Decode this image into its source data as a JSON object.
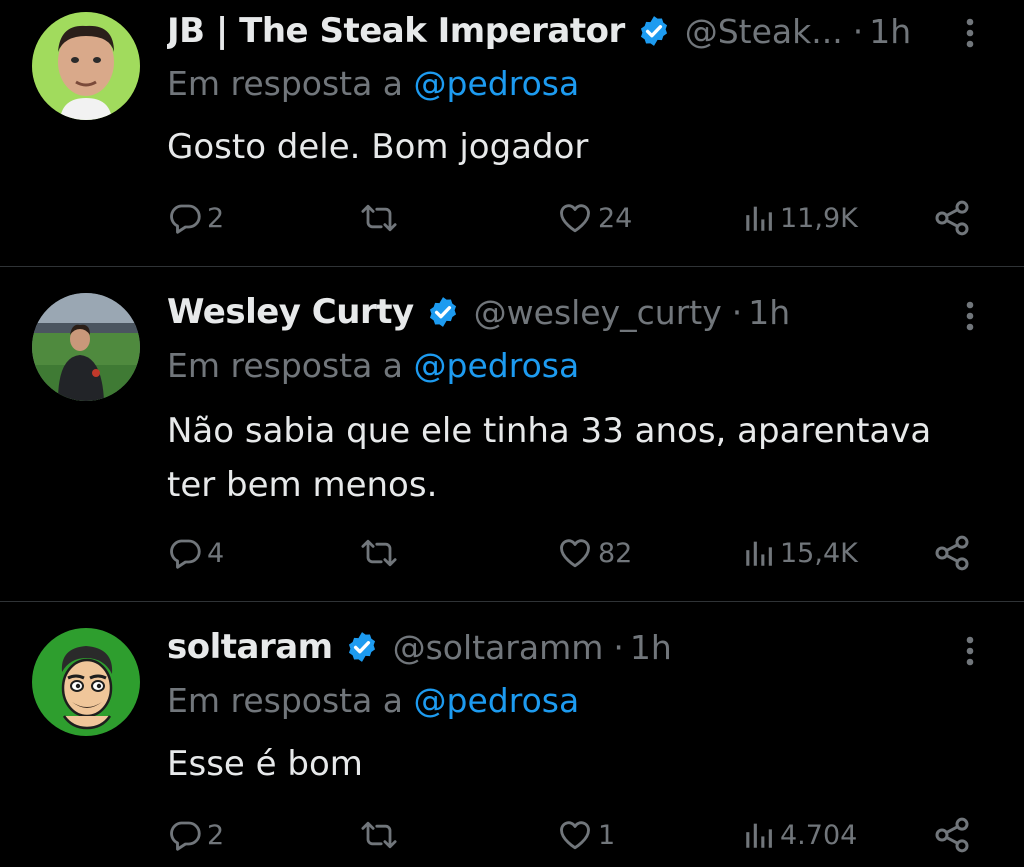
{
  "tweets": [
    {
      "name": "JB | The Steak Imperator",
      "handle": "@Steak...",
      "separator": "·",
      "time": "1h",
      "reply_prefix": "Em resposta a",
      "reply_to": "@pedrosa",
      "text": "Gosto dele. Bom jogador",
      "replies": "2",
      "likes": "24",
      "views": "11,9K",
      "avatar_bg": "#8cd43a"
    },
    {
      "name": "Wesley Curty",
      "handle": "@wesley_curty",
      "separator": "·",
      "time": "1h",
      "reply_prefix": "Em resposta a",
      "reply_to": "@pedrosa",
      "text": "Não sabia que ele tinha 33 anos, aparentava ter bem menos.",
      "replies": "4",
      "likes": "82",
      "views": "15,4K",
      "avatar_bg": "#3d6b3a"
    },
    {
      "name": "soltaram",
      "handle": "@soltaramm",
      "separator": "·",
      "time": "1h",
      "reply_prefix": "Em resposta a",
      "reply_to": "@pedrosa",
      "text": "Esse é bom",
      "replies": "2",
      "likes": "1",
      "views": "4.704",
      "avatar_bg": "#2e9e2e"
    }
  ],
  "icons": {
    "verified": "verified-badge-icon",
    "more": "more-vertical-icon",
    "reply": "reply-icon",
    "retweet": "retweet-icon",
    "like": "heart-icon",
    "views": "views-chart-icon",
    "share": "share-icon"
  },
  "colors": {
    "background": "#000000",
    "text": "#e7e9ea",
    "muted": "#71767b",
    "accent": "#1d9bf0",
    "divider": "#2f3336"
  }
}
